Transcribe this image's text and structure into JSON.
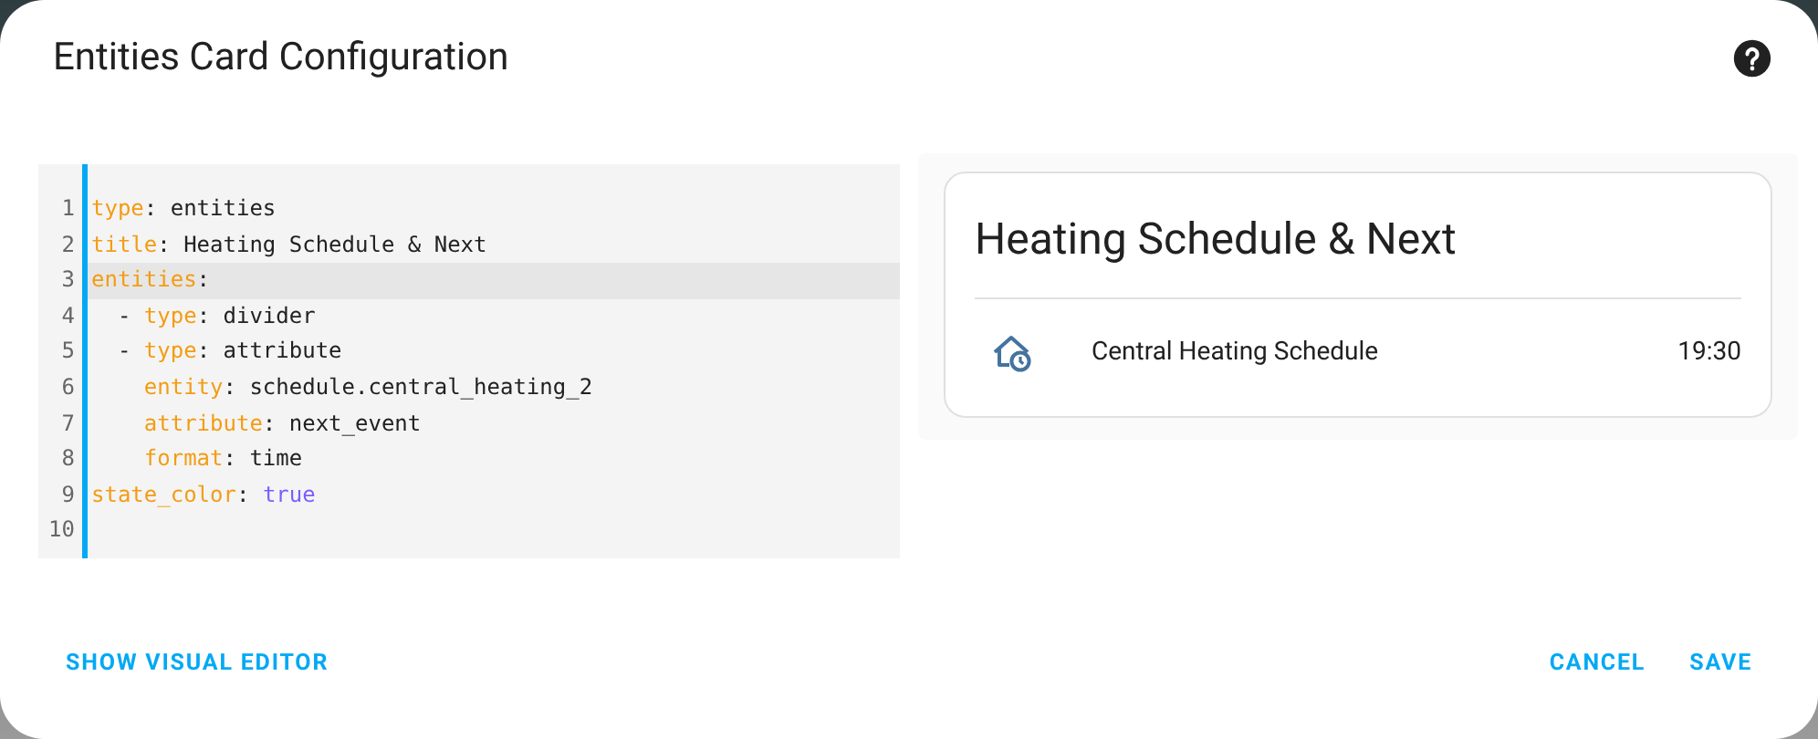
{
  "dialog": {
    "title": "Entities Card Configuration"
  },
  "editor": {
    "lines": [
      {
        "number": "1",
        "current": false,
        "tokens": [
          {
            "text": "type",
            "kind": "key"
          },
          {
            "text": ": entities",
            "kind": "plain"
          }
        ]
      },
      {
        "number": "2",
        "current": false,
        "tokens": [
          {
            "text": "title",
            "kind": "key"
          },
          {
            "text": ": Heating Schedule & Next",
            "kind": "plain"
          }
        ]
      },
      {
        "number": "3",
        "current": true,
        "tokens": [
          {
            "text": "entities",
            "kind": "key"
          },
          {
            "text": ":",
            "kind": "plain"
          }
        ]
      },
      {
        "number": "4",
        "current": false,
        "tokens": [
          {
            "text": "  - ",
            "kind": "plain"
          },
          {
            "text": "type",
            "kind": "key"
          },
          {
            "text": ": divider",
            "kind": "plain"
          }
        ]
      },
      {
        "number": "5",
        "current": false,
        "tokens": [
          {
            "text": "  - ",
            "kind": "plain"
          },
          {
            "text": "type",
            "kind": "key"
          },
          {
            "text": ": attribute",
            "kind": "plain"
          }
        ]
      },
      {
        "number": "6",
        "current": false,
        "tokens": [
          {
            "text": "    entity",
            "kind": "key"
          },
          {
            "text": ": schedule.central_heating_2",
            "kind": "plain"
          }
        ]
      },
      {
        "number": "7",
        "current": false,
        "tokens": [
          {
            "text": "    attribute",
            "kind": "key"
          },
          {
            "text": ": next_event",
            "kind": "plain"
          }
        ]
      },
      {
        "number": "8",
        "current": false,
        "tokens": [
          {
            "text": "    format",
            "kind": "key"
          },
          {
            "text": ": time",
            "kind": "plain"
          }
        ]
      },
      {
        "number": "9",
        "current": false,
        "tokens": [
          {
            "text": "state_color",
            "kind": "key"
          },
          {
            "text": ": ",
            "kind": "plain"
          },
          {
            "text": "true",
            "kind": "boolean"
          }
        ]
      },
      {
        "number": "10",
        "current": false
      }
    ]
  },
  "preview": {
    "title": "Heating Schedule & Next",
    "rows": [
      {
        "name": "Central Heating Schedule",
        "state": "19:30"
      }
    ]
  },
  "footer": {
    "left_button": "SHOW VISUAL EDITOR",
    "buttons": [
      "CANCEL",
      "SAVE"
    ]
  }
}
